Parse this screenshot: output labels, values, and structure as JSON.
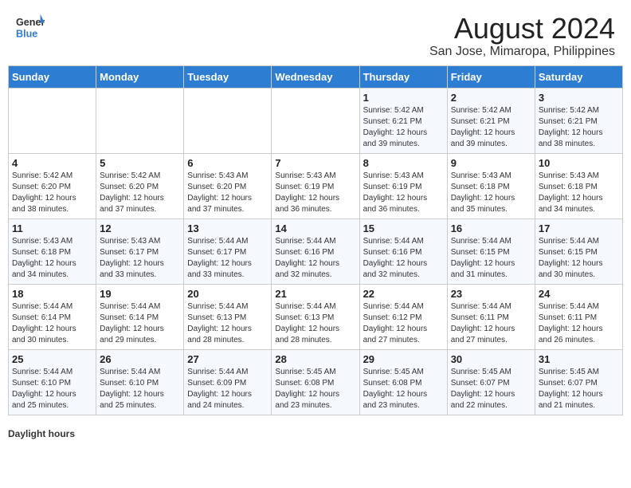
{
  "header": {
    "logo_line1": "General",
    "logo_line2": "Blue",
    "title": "August 2024",
    "subtitle": "San Jose, Mimaropa, Philippines"
  },
  "days_of_week": [
    "Sunday",
    "Monday",
    "Tuesday",
    "Wednesday",
    "Thursday",
    "Friday",
    "Saturday"
  ],
  "weeks": [
    [
      {
        "day": "",
        "info": ""
      },
      {
        "day": "",
        "info": ""
      },
      {
        "day": "",
        "info": ""
      },
      {
        "day": "",
        "info": ""
      },
      {
        "day": "1",
        "info": "Sunrise: 5:42 AM\nSunset: 6:21 PM\nDaylight: 12 hours\nand 39 minutes."
      },
      {
        "day": "2",
        "info": "Sunrise: 5:42 AM\nSunset: 6:21 PM\nDaylight: 12 hours\nand 39 minutes."
      },
      {
        "day": "3",
        "info": "Sunrise: 5:42 AM\nSunset: 6:21 PM\nDaylight: 12 hours\nand 38 minutes."
      }
    ],
    [
      {
        "day": "4",
        "info": "Sunrise: 5:42 AM\nSunset: 6:20 PM\nDaylight: 12 hours\nand 38 minutes."
      },
      {
        "day": "5",
        "info": "Sunrise: 5:42 AM\nSunset: 6:20 PM\nDaylight: 12 hours\nand 37 minutes."
      },
      {
        "day": "6",
        "info": "Sunrise: 5:43 AM\nSunset: 6:20 PM\nDaylight: 12 hours\nand 37 minutes."
      },
      {
        "day": "7",
        "info": "Sunrise: 5:43 AM\nSunset: 6:19 PM\nDaylight: 12 hours\nand 36 minutes."
      },
      {
        "day": "8",
        "info": "Sunrise: 5:43 AM\nSunset: 6:19 PM\nDaylight: 12 hours\nand 36 minutes."
      },
      {
        "day": "9",
        "info": "Sunrise: 5:43 AM\nSunset: 6:18 PM\nDaylight: 12 hours\nand 35 minutes."
      },
      {
        "day": "10",
        "info": "Sunrise: 5:43 AM\nSunset: 6:18 PM\nDaylight: 12 hours\nand 34 minutes."
      }
    ],
    [
      {
        "day": "11",
        "info": "Sunrise: 5:43 AM\nSunset: 6:18 PM\nDaylight: 12 hours\nand 34 minutes."
      },
      {
        "day": "12",
        "info": "Sunrise: 5:43 AM\nSunset: 6:17 PM\nDaylight: 12 hours\nand 33 minutes."
      },
      {
        "day": "13",
        "info": "Sunrise: 5:44 AM\nSunset: 6:17 PM\nDaylight: 12 hours\nand 33 minutes."
      },
      {
        "day": "14",
        "info": "Sunrise: 5:44 AM\nSunset: 6:16 PM\nDaylight: 12 hours\nand 32 minutes."
      },
      {
        "day": "15",
        "info": "Sunrise: 5:44 AM\nSunset: 6:16 PM\nDaylight: 12 hours\nand 32 minutes."
      },
      {
        "day": "16",
        "info": "Sunrise: 5:44 AM\nSunset: 6:15 PM\nDaylight: 12 hours\nand 31 minutes."
      },
      {
        "day": "17",
        "info": "Sunrise: 5:44 AM\nSunset: 6:15 PM\nDaylight: 12 hours\nand 30 minutes."
      }
    ],
    [
      {
        "day": "18",
        "info": "Sunrise: 5:44 AM\nSunset: 6:14 PM\nDaylight: 12 hours\nand 30 minutes."
      },
      {
        "day": "19",
        "info": "Sunrise: 5:44 AM\nSunset: 6:14 PM\nDaylight: 12 hours\nand 29 minutes."
      },
      {
        "day": "20",
        "info": "Sunrise: 5:44 AM\nSunset: 6:13 PM\nDaylight: 12 hours\nand 28 minutes."
      },
      {
        "day": "21",
        "info": "Sunrise: 5:44 AM\nSunset: 6:13 PM\nDaylight: 12 hours\nand 28 minutes."
      },
      {
        "day": "22",
        "info": "Sunrise: 5:44 AM\nSunset: 6:12 PM\nDaylight: 12 hours\nand 27 minutes."
      },
      {
        "day": "23",
        "info": "Sunrise: 5:44 AM\nSunset: 6:11 PM\nDaylight: 12 hours\nand 27 minutes."
      },
      {
        "day": "24",
        "info": "Sunrise: 5:44 AM\nSunset: 6:11 PM\nDaylight: 12 hours\nand 26 minutes."
      }
    ],
    [
      {
        "day": "25",
        "info": "Sunrise: 5:44 AM\nSunset: 6:10 PM\nDaylight: 12 hours\nand 25 minutes."
      },
      {
        "day": "26",
        "info": "Sunrise: 5:44 AM\nSunset: 6:10 PM\nDaylight: 12 hours\nand 25 minutes."
      },
      {
        "day": "27",
        "info": "Sunrise: 5:44 AM\nSunset: 6:09 PM\nDaylight: 12 hours\nand 24 minutes."
      },
      {
        "day": "28",
        "info": "Sunrise: 5:45 AM\nSunset: 6:08 PM\nDaylight: 12 hours\nand 23 minutes."
      },
      {
        "day": "29",
        "info": "Sunrise: 5:45 AM\nSunset: 6:08 PM\nDaylight: 12 hours\nand 23 minutes."
      },
      {
        "day": "30",
        "info": "Sunrise: 5:45 AM\nSunset: 6:07 PM\nDaylight: 12 hours\nand 22 minutes."
      },
      {
        "day": "31",
        "info": "Sunrise: 5:45 AM\nSunset: 6:07 PM\nDaylight: 12 hours\nand 21 minutes."
      }
    ]
  ],
  "legend": {
    "label": "Daylight hours"
  }
}
